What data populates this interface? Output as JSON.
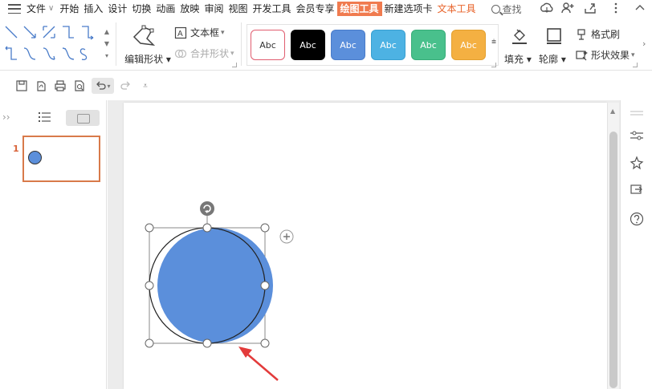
{
  "menubar": {
    "file": "文件",
    "items": [
      "开始",
      "插入",
      "设计",
      "切换",
      "动画",
      "放映",
      "审阅",
      "视图",
      "开发工具",
      "会员专享"
    ],
    "active_tab": "绘图工具",
    "new_tab": "新建选项卡",
    "text_tools": "文本工具",
    "search": "查找"
  },
  "ribbon": {
    "edit_shape": "编辑形状",
    "textbox": "文本框",
    "merge_shape": "合并形状",
    "styles": [
      {
        "label": "Abc",
        "bg": "#ffffff",
        "border": "#e05d6f",
        "text": "#333333"
      },
      {
        "label": "Abc",
        "bg": "#000000",
        "border": "#000000",
        "text": "#ffffff"
      },
      {
        "label": "Abc",
        "bg": "#5b8fdb",
        "border": "#4a7cc9",
        "text": "#ffffff"
      },
      {
        "label": "Abc",
        "bg": "#4db2e3",
        "border": "#3aa0d1",
        "text": "#ffffff"
      },
      {
        "label": "Abc",
        "bg": "#49c08c",
        "border": "#38ad79",
        "text": "#ffffff"
      },
      {
        "label": "Abc",
        "bg": "#f4b042",
        "border": "#e3a030",
        "text": "#ffffff"
      }
    ],
    "fill": "填充",
    "outline": "轮廓",
    "format_painter": "格式刷",
    "shape_effect": "形状效果"
  },
  "slides_panel": {
    "slide_number": "1"
  },
  "colors": {
    "accent": "#f07b4f",
    "circle_fill": "#5b8fdb",
    "arrow": "#e33b3b"
  }
}
